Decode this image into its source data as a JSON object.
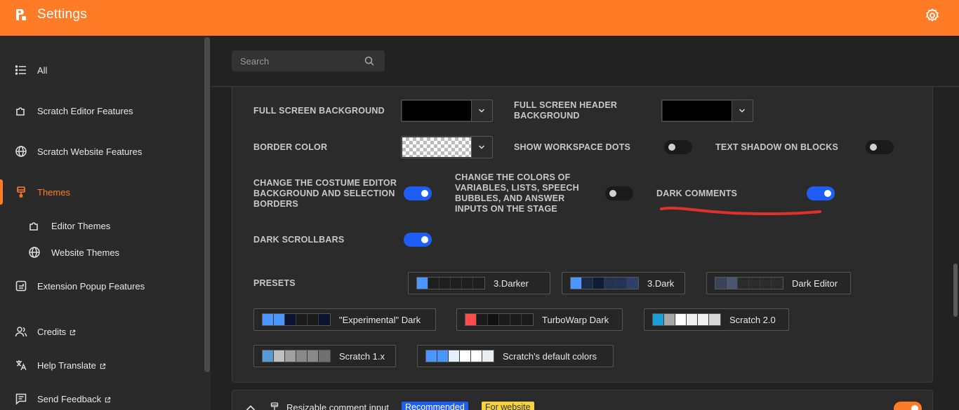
{
  "header": {
    "title": "Settings",
    "logo_icon": "addons-logo-icon",
    "settings_icon": "gear-icon",
    "accent": "#ff7b26"
  },
  "sidebar": {
    "items": [
      {
        "label": "All",
        "icon": "list-icon"
      },
      {
        "label": "Scratch Editor Features",
        "icon": "puzzle-icon"
      },
      {
        "label": "Scratch Website Features",
        "icon": "globe-icon"
      },
      {
        "label": "Themes",
        "icon": "brush-icon",
        "active": true
      },
      {
        "label": "Editor Themes",
        "icon": "puzzle-icon",
        "sub": true
      },
      {
        "label": "Website Themes",
        "icon": "globe-icon",
        "sub": true
      },
      {
        "label": "Extension Popup Features",
        "icon": "popup-icon"
      },
      {
        "label": "Credits",
        "icon": "users-icon",
        "external": true
      },
      {
        "label": "Help Translate",
        "icon": "translate-icon",
        "external": true
      },
      {
        "label": "Send Feedback",
        "icon": "feedback-icon",
        "external": true
      }
    ]
  },
  "search": {
    "placeholder": "Search",
    "value": ""
  },
  "settings": {
    "full_screen_background": "Full screen background",
    "full_screen_header_background": "Full screen header background",
    "border_color": "Border color",
    "show_workspace_dots": "Show workspace dots",
    "text_shadow_on_blocks": "Text shadow on blocks",
    "costume_editor": "Change the costume editor background and selection borders",
    "stage_colors": "Change the colors of variables, lists, speech bubbles, and answer inputs on the stage",
    "dark_comments": "Dark comments",
    "dark_scrollbars": "Dark scrollbars",
    "presets": "Presets"
  },
  "toggles": {
    "show_workspace_dots": false,
    "text_shadow_on_blocks": false,
    "costume_editor": true,
    "stage_colors": false,
    "dark_comments": true,
    "dark_scrollbars": true
  },
  "presets": [
    {
      "name": "3.Darker",
      "colors": [
        "#4c97ff",
        "#1e1e1e",
        "#1e1e1e",
        "#1e1e1e",
        "#1e1e1e",
        "#1e1e1e"
      ]
    },
    {
      "name": "3.Dark",
      "colors": [
        "#4c97ff",
        "#1c2a4a",
        "#0f1a35",
        "#243456",
        "#243456",
        "#2e3f6b"
      ]
    },
    {
      "name": "Dark Editor",
      "colors": [
        "#3b4456",
        "#4a5670",
        "#2b2b2b",
        "#2b2b2b",
        "#2b2b2b",
        "#2b2b2b"
      ]
    },
    {
      "name": "\"Experimental\" Dark",
      "colors": [
        "#4c97ff",
        "#4c97ff",
        "#0b1530",
        "#1a1a1a",
        "#1a1a1a",
        "#0b1530"
      ]
    },
    {
      "name": "TurboWarp Dark",
      "colors": [
        "#ff4c4c",
        "#1a1a1a",
        "#111111",
        "#1a1a1a",
        "#1a1a1a",
        "#1a1a1a"
      ]
    },
    {
      "name": "Scratch 2.0",
      "colors": [
        "#1aa0d8",
        "#a8a8a8",
        "#ffffff",
        "#f0f0f0",
        "#f0f0f0",
        "#d8d8d8"
      ]
    },
    {
      "name": "Scratch 1.x",
      "colors": [
        "#5a9bd5",
        "#c0c0c0",
        "#a0a0a0",
        "#8a8a8a",
        "#8a8a8a",
        "#707070"
      ]
    },
    {
      "name": "Scratch's default colors",
      "colors": [
        "#4c97ff",
        "#4c97ff",
        "#e5f0ff",
        "#ffffff",
        "#ffffff",
        "#e9eef2"
      ]
    }
  ],
  "addon": {
    "name": "Resizable comment input",
    "tags": {
      "recommended": "Recommended",
      "for_website": "For website"
    },
    "enabled": true
  }
}
